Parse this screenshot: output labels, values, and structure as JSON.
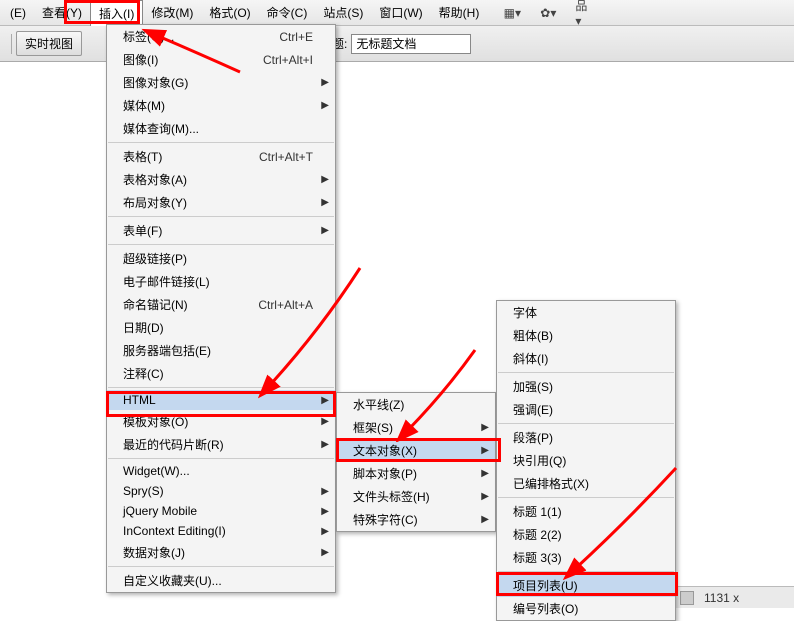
{
  "menubar": {
    "items": [
      {
        "label": "(E)"
      },
      {
        "label": "查看(Y)"
      },
      {
        "label": "插入(I)"
      },
      {
        "label": "修改(M)"
      },
      {
        "label": "格式(O)"
      },
      {
        "label": "命令(C)"
      },
      {
        "label": "站点(S)"
      },
      {
        "label": "窗口(W)"
      },
      {
        "label": "帮助(H)"
      }
    ]
  },
  "secondary": {
    "button": "实时视图",
    "label": "标题:",
    "input_value": "无标题文档"
  },
  "menu1": {
    "items": [
      {
        "label": "标签(G)...",
        "shortcut": "Ctrl+E"
      },
      {
        "label": "图像(I)",
        "shortcut": "Ctrl+Alt+I"
      },
      {
        "label": "图像对象(G)",
        "arrow": true
      },
      {
        "label": "媒体(M)",
        "arrow": true
      },
      {
        "label": "媒体查询(M)..."
      },
      {
        "sep": true
      },
      {
        "label": "表格(T)",
        "shortcut": "Ctrl+Alt+T"
      },
      {
        "label": "表格对象(A)",
        "arrow": true
      },
      {
        "label": "布局对象(Y)",
        "arrow": true
      },
      {
        "sep": true
      },
      {
        "label": "表单(F)",
        "arrow": true
      },
      {
        "sep": true
      },
      {
        "label": "超级链接(P)"
      },
      {
        "label": "电子邮件链接(L)"
      },
      {
        "label": "命名锚记(N)",
        "shortcut": "Ctrl+Alt+A"
      },
      {
        "label": "日期(D)"
      },
      {
        "label": "服务器端包括(E)"
      },
      {
        "label": "注释(C)"
      },
      {
        "sep": true
      },
      {
        "label": "HTML",
        "arrow": true,
        "selected": true
      },
      {
        "label": "模板对象(O)",
        "arrow": true
      },
      {
        "label": "最近的代码片断(R)",
        "arrow": true
      },
      {
        "sep": true
      },
      {
        "label": "Widget(W)..."
      },
      {
        "label": "Spry(S)",
        "arrow": true
      },
      {
        "label": "jQuery Mobile",
        "arrow": true
      },
      {
        "label": "InContext Editing(I)",
        "arrow": true
      },
      {
        "label": "数据对象(J)",
        "arrow": true
      },
      {
        "sep": true
      },
      {
        "label": "自定义收藏夹(U)..."
      }
    ]
  },
  "menu2": {
    "items": [
      {
        "label": "水平线(Z)"
      },
      {
        "label": "框架(S)",
        "arrow": true
      },
      {
        "label": "文本对象(X)",
        "arrow": true,
        "selected": true
      },
      {
        "label": "脚本对象(P)",
        "arrow": true
      },
      {
        "label": "文件头标签(H)",
        "arrow": true
      },
      {
        "label": "特殊字符(C)",
        "arrow": true
      }
    ]
  },
  "menu3": {
    "items": [
      {
        "label": "字体"
      },
      {
        "label": "粗体(B)"
      },
      {
        "label": "斜体(I)"
      },
      {
        "sep": true
      },
      {
        "label": "加强(S)"
      },
      {
        "label": "强调(E)"
      },
      {
        "sep": true
      },
      {
        "label": "段落(P)"
      },
      {
        "label": "块引用(Q)"
      },
      {
        "label": "已编排格式(X)"
      },
      {
        "sep": true
      },
      {
        "label": "标题 1(1)"
      },
      {
        "label": "标题 2(2)"
      },
      {
        "label": "标题 3(3)"
      },
      {
        "sep": true
      },
      {
        "label": "项目列表(U)",
        "selected": true
      },
      {
        "label": "编号列表(O)"
      }
    ]
  },
  "status": {
    "value": "1131 x"
  }
}
